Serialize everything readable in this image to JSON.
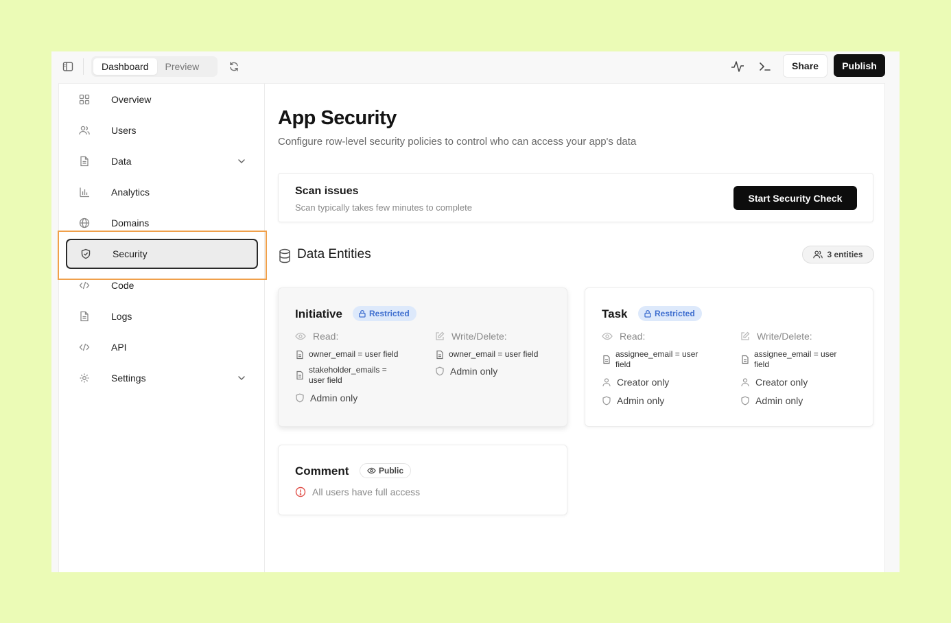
{
  "topbar": {
    "tabs": [
      {
        "label": "Dashboard"
      },
      {
        "label": "Preview"
      }
    ],
    "share_label": "Share",
    "publish_label": "Publish"
  },
  "sidebar": {
    "items": [
      {
        "label": "Overview",
        "icon": "grid-icon"
      },
      {
        "label": "Users",
        "icon": "users-icon"
      },
      {
        "label": "Data",
        "icon": "file-icon",
        "has_chevron": true
      },
      {
        "label": "Analytics",
        "icon": "bar-chart-icon"
      },
      {
        "label": "Domains",
        "icon": "globe-icon"
      },
      {
        "label": "Security",
        "icon": "shield-icon",
        "selected": true
      },
      {
        "label": "Code",
        "icon": "code-icon"
      },
      {
        "label": "Logs",
        "icon": "file-icon"
      },
      {
        "label": "API",
        "icon": "code-icon"
      },
      {
        "label": "Settings",
        "icon": "gear-icon",
        "has_chevron": true
      }
    ]
  },
  "main": {
    "title": "App Security",
    "subtitle": "Configure row-level security policies to control who can access your app's data",
    "scan": {
      "title": "Scan issues",
      "subtitle": "Scan typically takes few minutes to complete",
      "button_label": "Start Security Check"
    },
    "entities": {
      "title": "Data Entities",
      "count_label": "3 entities",
      "cards": [
        {
          "name": "Initiative",
          "badge": "Restricted",
          "read_label": "Read:",
          "write_label": "Write/Delete:",
          "read_rules": [
            "owner_email = user field",
            "stakeholder_emails =",
            "user field",
            "Admin only"
          ],
          "write_rules": [
            "owner_email = user field",
            "Admin only"
          ]
        },
        {
          "name": "Task",
          "badge": "Restricted",
          "read_label": "Read:",
          "write_label": "Write/Delete:",
          "read_rules": [
            "assignee_email = user",
            "field",
            "Creator only",
            "Admin only"
          ],
          "write_rules": [
            "assignee_email = user",
            "field",
            "Creator only",
            "Admin only"
          ]
        },
        {
          "name": "Comment",
          "badge": "Public",
          "note": "All users have full access"
        }
      ]
    }
  },
  "colors": {
    "background": "#ebfbb6",
    "highlight": "#f0a04b",
    "restricted_badge_bg": "#dde9fb",
    "restricted_badge_text": "#3f6fcf",
    "warning": "#e0524c",
    "primary_button": "#111111"
  }
}
